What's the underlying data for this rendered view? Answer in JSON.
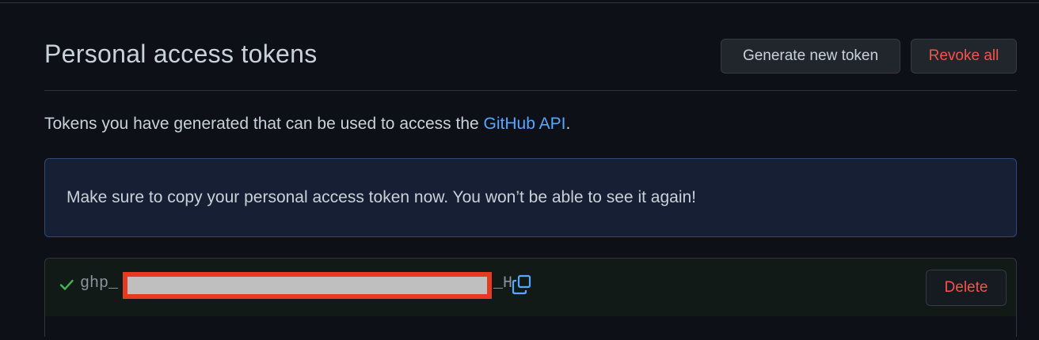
{
  "header": {
    "title": "Personal access tokens",
    "generate_button_label": "Generate new token",
    "revoke_button_label": "Revoke all"
  },
  "description": {
    "text_before": "Tokens you have generated that can be used to access the ",
    "link_text": "GitHub API",
    "text_after": "."
  },
  "flash": {
    "message": "Make sure to copy your personal access token now. You won’t be able to see it again!"
  },
  "token": {
    "prefix": "ghp_",
    "suffix": "_H",
    "status_icon": "check-icon",
    "copy_icon": "copy-icon",
    "redacted": true,
    "delete_label": "Delete"
  },
  "colors": {
    "background": "#0d1117",
    "link": "#58a6ff",
    "danger": "#f85149",
    "success": "#3fb950",
    "flash_border": "#2f4a7d"
  }
}
